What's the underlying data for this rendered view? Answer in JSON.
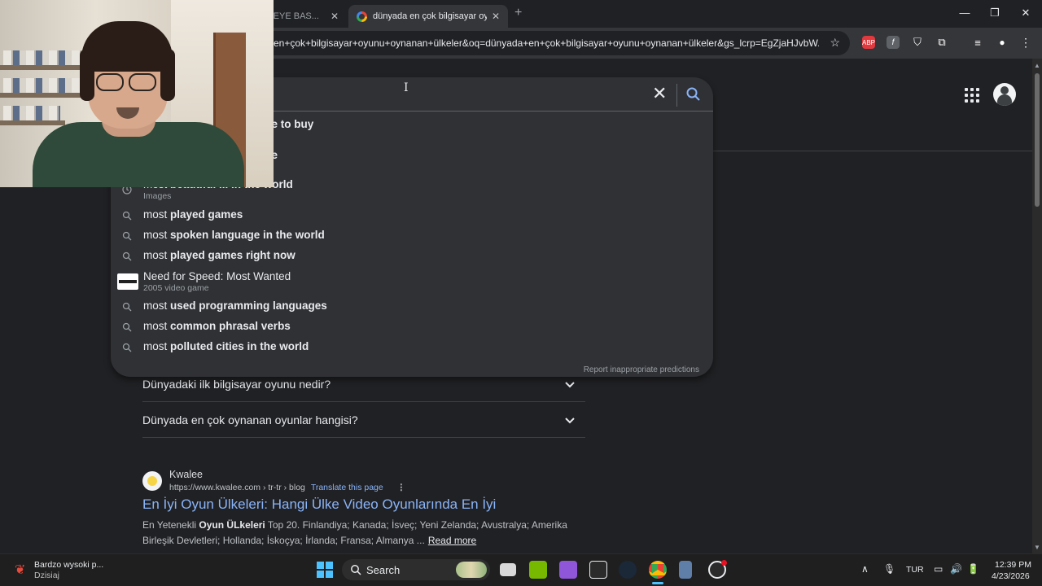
{
  "browser": {
    "tabs": [
      {
        "title": "ÜĞMEYE BAS..."
      },
      {
        "title": "dünyada en çok bilgisayar oyu"
      }
    ],
    "new_tab": "+",
    "window_controls": {
      "minimize": "—",
      "maximize": "❐",
      "close": "✕"
    },
    "address": "en+çok+bilgisayar+oyunu+oynanan+ülkeler&oq=dünyada+en+çok+bilgisayar+oyunu+oynanan+ülkeler&gs_lcrp=EgZjaHJvbW...",
    "extensions": [
      {
        "name": "adblock-icon",
        "label": "ABP",
        "color": "#e0393e"
      },
      {
        "name": "font-extension-icon",
        "label": "f",
        "color": "#5f6368"
      },
      {
        "name": "shield-extension-icon",
        "label": "⛉",
        "color": "#202124"
      },
      {
        "name": "puzzle-icon",
        "label": "⧉",
        "color": "#202124"
      },
      {
        "name": "media-icon",
        "label": "≡",
        "color": "#202124"
      },
      {
        "name": "profile-icon",
        "label": "●",
        "color": "#202124"
      },
      {
        "name": "menu-icon",
        "label": "⋮",
        "color": "#202124"
      }
    ]
  },
  "search_dropdown": {
    "suggestions_partial": [
      {
        "prefix": "",
        "bold": "ce to buy"
      },
      {
        "prefix": "",
        "bold": "ce"
      },
      {
        "prefix": "most ",
        "bold": "beautiful ... in the world",
        "sub": "Images"
      }
    ],
    "suggestions": [
      {
        "prefix": "most ",
        "bold": "played games"
      },
      {
        "prefix": "most ",
        "bold": "spoken language in the world"
      },
      {
        "prefix": "most ",
        "bold": "played games right now"
      },
      {
        "prefix": "Need for Speed: Most Wanted",
        "bold": "",
        "sub": "2005 video game",
        "thumb": true
      },
      {
        "prefix": "most ",
        "bold": "used programming languages"
      },
      {
        "prefix": "most ",
        "bold": "common phrasal verbs"
      },
      {
        "prefix": "most ",
        "bold": "polluted cities in the world"
      }
    ],
    "report_link": "Report inappropriate predictions"
  },
  "results": {
    "faqs": [
      "Dünyadaki ilk bilgisayar oyunu nedir?",
      "Dünyada en çok oynanan oyunlar hangisi?"
    ],
    "result": {
      "site": "Kwalee",
      "url": "https://www.kwalee.com › tr-tr › blog",
      "translate": "Translate this page",
      "title": "En İyi Oyun Ülkeleri: Hangi Ülke Video Oyunlarında En İyi",
      "snippet_pre": "En Yetenekli ",
      "snippet_bold": "Oyun ÜLkeleri",
      "snippet_post": " Top 20. Finlandiya; Kanada; İsveç; Yeni Zelanda; Avustralya; Amerika Birleşik Devletleri; Hollanda; İskoçya; İrlanda; Fransa; Almanya ...",
      "read_more": "Read more"
    }
  },
  "taskbar": {
    "notification_title": "Bardzo wysoki p...",
    "notification_sub": "Dzisiaj",
    "search_label": "Search",
    "language": "TUR",
    "time": "12:39 PM",
    "date": "4/23/2026"
  }
}
